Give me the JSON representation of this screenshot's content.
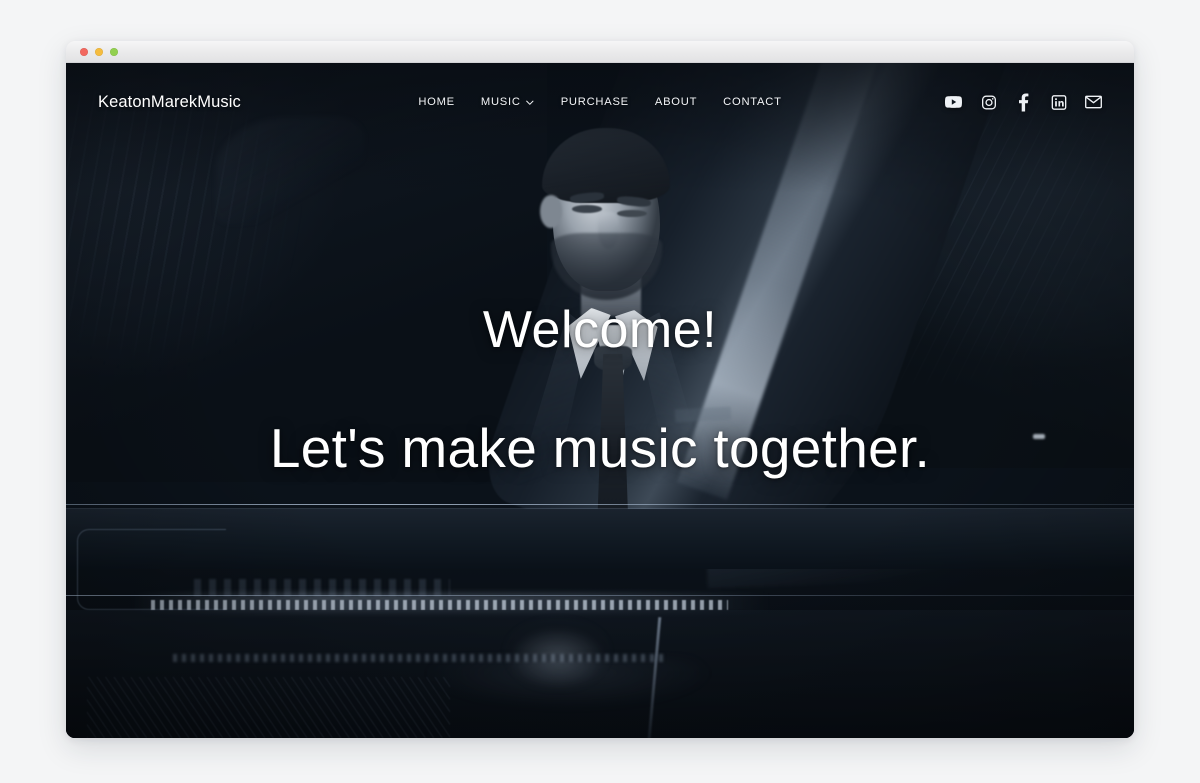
{
  "page": {
    "background_color": "#f4f5f6"
  },
  "window": {
    "chrome": {
      "traffic_lights": [
        {
          "name": "close",
          "color": "#f2685f"
        },
        {
          "name": "minimize",
          "color": "#f5bc3e"
        },
        {
          "name": "maximize",
          "color": "#92d04f"
        }
      ]
    }
  },
  "site": {
    "logo": "KeatonMarekMusic",
    "nav": [
      {
        "label": "HOME",
        "has_dropdown": false
      },
      {
        "label": "MUSIC",
        "has_dropdown": true
      },
      {
        "label": "PURCHASE",
        "has_dropdown": false
      },
      {
        "label": "ABOUT",
        "has_dropdown": false
      },
      {
        "label": "CONTACT",
        "has_dropdown": false
      }
    ],
    "social": [
      {
        "name": "youtube-icon",
        "label": "YouTube"
      },
      {
        "name": "instagram-icon",
        "label": "Instagram"
      },
      {
        "name": "facebook-icon",
        "label": "Facebook"
      },
      {
        "name": "linkedin-icon",
        "label": "LinkedIn"
      },
      {
        "name": "email-icon",
        "label": "Email"
      }
    ],
    "hero": {
      "line1": "Welcome!",
      "line2": "Let's make music together.",
      "text_color": "#ffffff",
      "image_description": "Black and white photo of a bearded man in a dark suit and tie seated at a grand piano, looking down, inside a dark vaulted hall"
    }
  }
}
